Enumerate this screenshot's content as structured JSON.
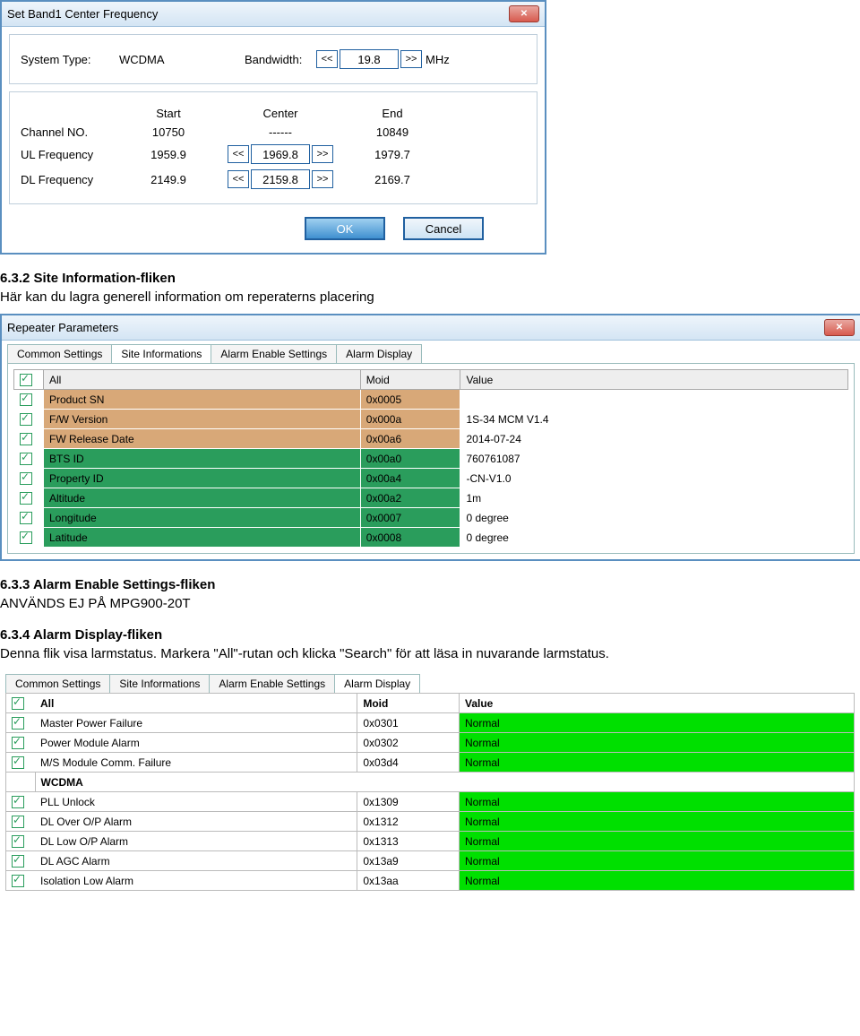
{
  "dialog1": {
    "title": "Set Band1 Center Frequency",
    "system_type_label": "System Type:",
    "system_type_value": "WCDMA",
    "bandwidth_label": "Bandwidth:",
    "bandwidth_value": "19.8",
    "bandwidth_unit": "MHz",
    "col_start": "Start",
    "col_center": "Center",
    "col_end": "End",
    "channel_label": "Channel NO.",
    "channel_start": "10750",
    "channel_center": "------",
    "channel_end": "10849",
    "ul_label": "UL Frequency",
    "ul_start": "1959.9",
    "ul_center": "1969.8",
    "ul_end": "1979.7",
    "dl_label": "DL Frequency",
    "dl_start": "2149.9",
    "dl_center": "2159.8",
    "dl_end": "2169.7",
    "ok": "OK",
    "cancel": "Cancel"
  },
  "sec632": {
    "heading": "6.3.2 Site Information-fliken",
    "text": "Här kan du lagra generell information om reperaterns placering"
  },
  "rp": {
    "title": "Repeater Parameters",
    "tabs": [
      "Common Settings",
      "Site Informations",
      "Alarm Enable Settings",
      "Alarm Display"
    ],
    "active_tab": 1,
    "cols": {
      "all": "All",
      "moid": "Moid",
      "value": "Value"
    },
    "rows": [
      {
        "name": "Product SN",
        "moid": "0x0005",
        "value": "",
        "cls": "tan"
      },
      {
        "name": "F/W Version",
        "moid": "0x000a",
        "value": "1S-34 MCM V1.4",
        "cls": "tan"
      },
      {
        "name": "FW Release Date",
        "moid": "0x00a6",
        "value": "2014-07-24",
        "cls": "tan"
      },
      {
        "name": "BTS ID",
        "moid": "0x00a0",
        "value": "760761087",
        "cls": "green"
      },
      {
        "name": "Property ID",
        "moid": "0x00a4",
        "value": "-CN-V1.0",
        "cls": "green"
      },
      {
        "name": "Altitude",
        "moid": "0x00a2",
        "value": "1m",
        "cls": "green"
      },
      {
        "name": "Longitude",
        "moid": "0x0007",
        "value": "0 degree",
        "cls": "green"
      },
      {
        "name": "Latitude",
        "moid": "0x0008",
        "value": "0 degree",
        "cls": "green"
      }
    ]
  },
  "sec633": {
    "heading": "6.3.3 Alarm Enable Settings-fliken",
    "text": "ANVÄNDS EJ PÅ MPG900-20T"
  },
  "sec634": {
    "heading": "6.3.4 Alarm Display-fliken",
    "text1": "Denna flik visa larmstatus. Markera \"All\"-rutan och klicka \"Search\" för att läsa in nuvarande larmstatus."
  },
  "ad": {
    "tabs": [
      "Common Settings",
      "Site Informations",
      "Alarm Enable Settings",
      "Alarm Display"
    ],
    "active_tab": 3,
    "cols": {
      "all": "All",
      "moid": "Moid",
      "value": "Value"
    },
    "group": "WCDMA",
    "rows_top": [
      {
        "name": "Master Power Failure",
        "moid": "0x0301",
        "value": "Normal"
      },
      {
        "name": "Power Module Alarm",
        "moid": "0x0302",
        "value": "Normal"
      },
      {
        "name": "M/S Module Comm. Failure",
        "moid": "0x03d4",
        "value": "Normal"
      }
    ],
    "rows_wcdma": [
      {
        "name": "PLL Unlock",
        "moid": "0x1309",
        "value": "Normal"
      },
      {
        "name": "DL Over O/P Alarm",
        "moid": "0x1312",
        "value": "Normal"
      },
      {
        "name": "DL Low O/P Alarm",
        "moid": "0x1313",
        "value": "Normal"
      },
      {
        "name": "DL AGC Alarm",
        "moid": "0x13a9",
        "value": "Normal"
      },
      {
        "name": "Isolation Low Alarm",
        "moid": "0x13aa",
        "value": "Normal"
      }
    ]
  }
}
